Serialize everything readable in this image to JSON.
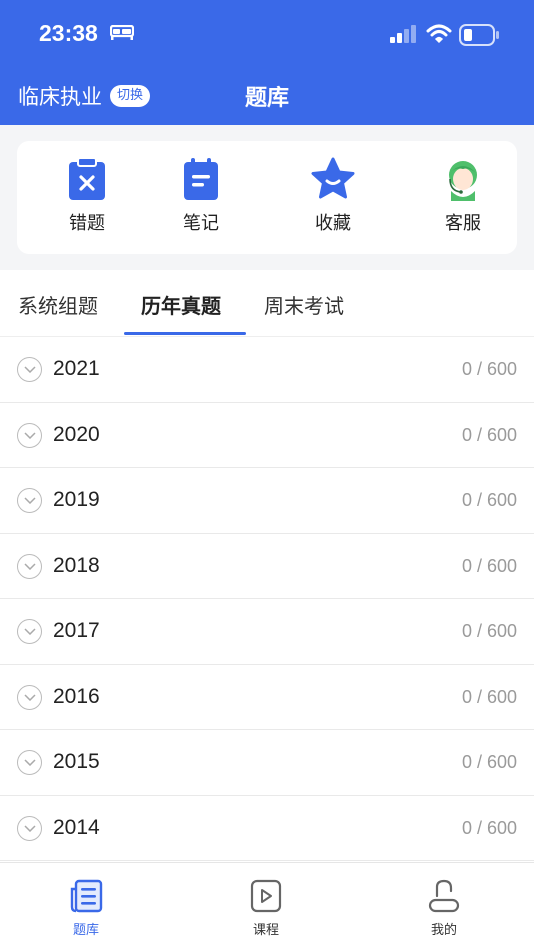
{
  "status": {
    "time": "23:38"
  },
  "nav": {
    "subject": "临床执业",
    "switch_label": "切换",
    "title": "题库"
  },
  "quick_actions": [
    {
      "label": "错题",
      "icon": "wrong-questions-icon"
    },
    {
      "label": "笔记",
      "icon": "notes-icon"
    },
    {
      "label": "收藏",
      "icon": "favorites-star-icon"
    },
    {
      "label": "客服",
      "icon": "customer-service-icon"
    }
  ],
  "tabs": [
    {
      "label": "系统组题",
      "active": false
    },
    {
      "label": "历年真题",
      "active": true
    },
    {
      "label": "周末考试",
      "active": false
    }
  ],
  "years": [
    {
      "year": "2021",
      "progress": "0 / 600"
    },
    {
      "year": "2020",
      "progress": "0 / 600"
    },
    {
      "year": "2019",
      "progress": "0 / 600"
    },
    {
      "year": "2018",
      "progress": "0 / 600"
    },
    {
      "year": "2017",
      "progress": "0 / 600"
    },
    {
      "year": "2016",
      "progress": "0 / 600"
    },
    {
      "year": "2015",
      "progress": "0 / 600"
    },
    {
      "year": "2014",
      "progress": "0 / 600"
    }
  ],
  "bottom_nav": [
    {
      "label": "题库",
      "icon": "question-bank-icon",
      "active": true
    },
    {
      "label": "课程",
      "icon": "course-play-icon",
      "active": false
    },
    {
      "label": "我的",
      "icon": "profile-icon",
      "active": false
    }
  ],
  "colors": {
    "accent": "#3a69e8",
    "avatar_green": "#4fbf6b"
  }
}
